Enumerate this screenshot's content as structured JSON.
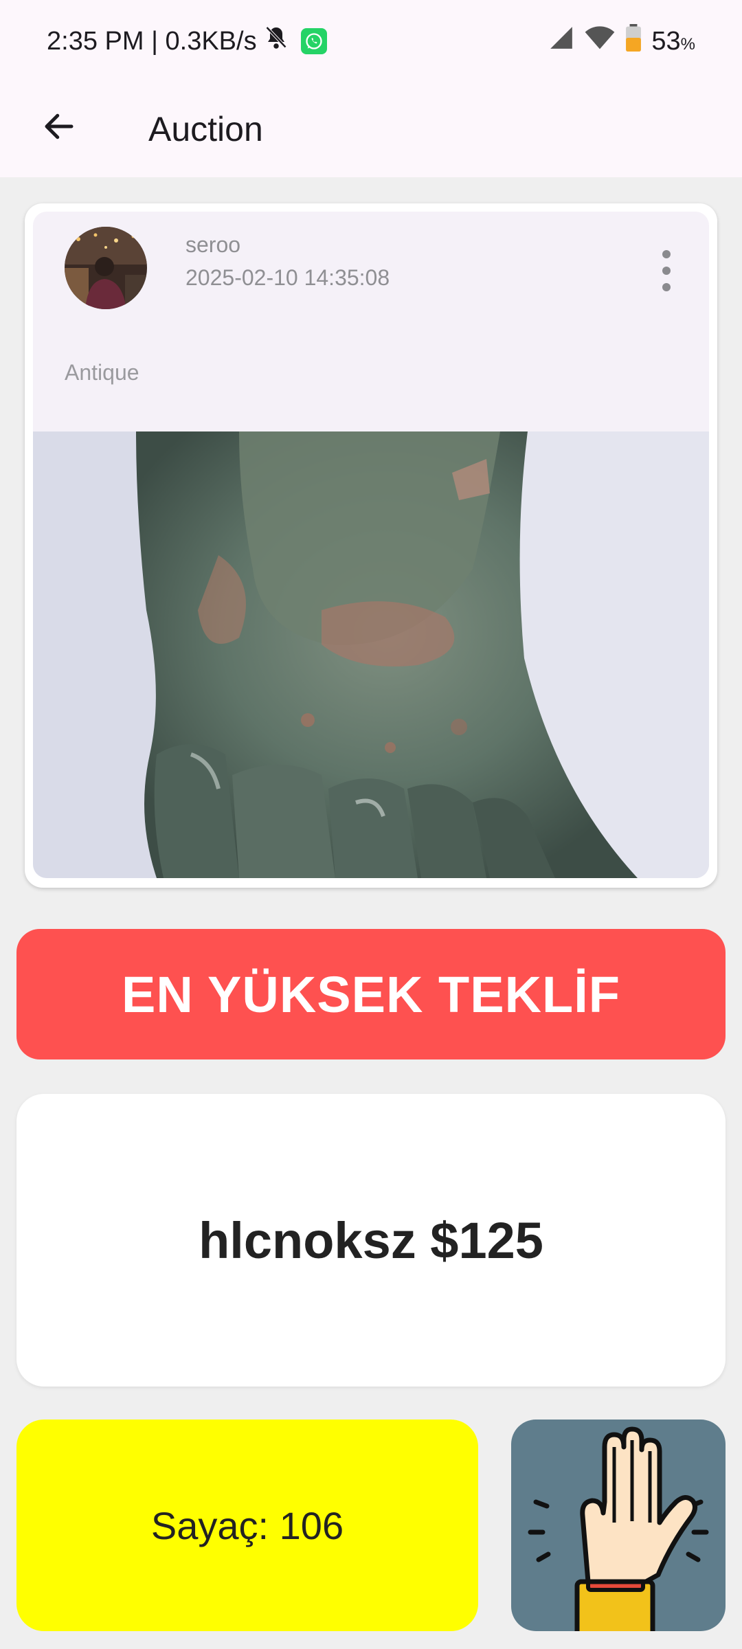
{
  "status_bar": {
    "time": "2:35 PM | 0.3KB/s",
    "battery_percent": "53",
    "battery_unit": "%"
  },
  "app_bar": {
    "title": "Auction",
    "back_icon": "arrow-left-icon"
  },
  "post": {
    "username": "seroo",
    "timestamp": "2025-02-10 14:35:08",
    "category": "Antique",
    "more_icon": "more-vertical-icon"
  },
  "auction": {
    "highest_bid_label": "EN YÜKSEK TEKLİF",
    "highest_bid_value": "hlcnoksz $125",
    "counter_text": "Sayaç: 106",
    "raise_hand_icon": "raise-hand-icon"
  },
  "colors": {
    "banner": "#fe5150",
    "counter": "#ffff00",
    "raise_hand_bg": "#5f7d8c"
  }
}
